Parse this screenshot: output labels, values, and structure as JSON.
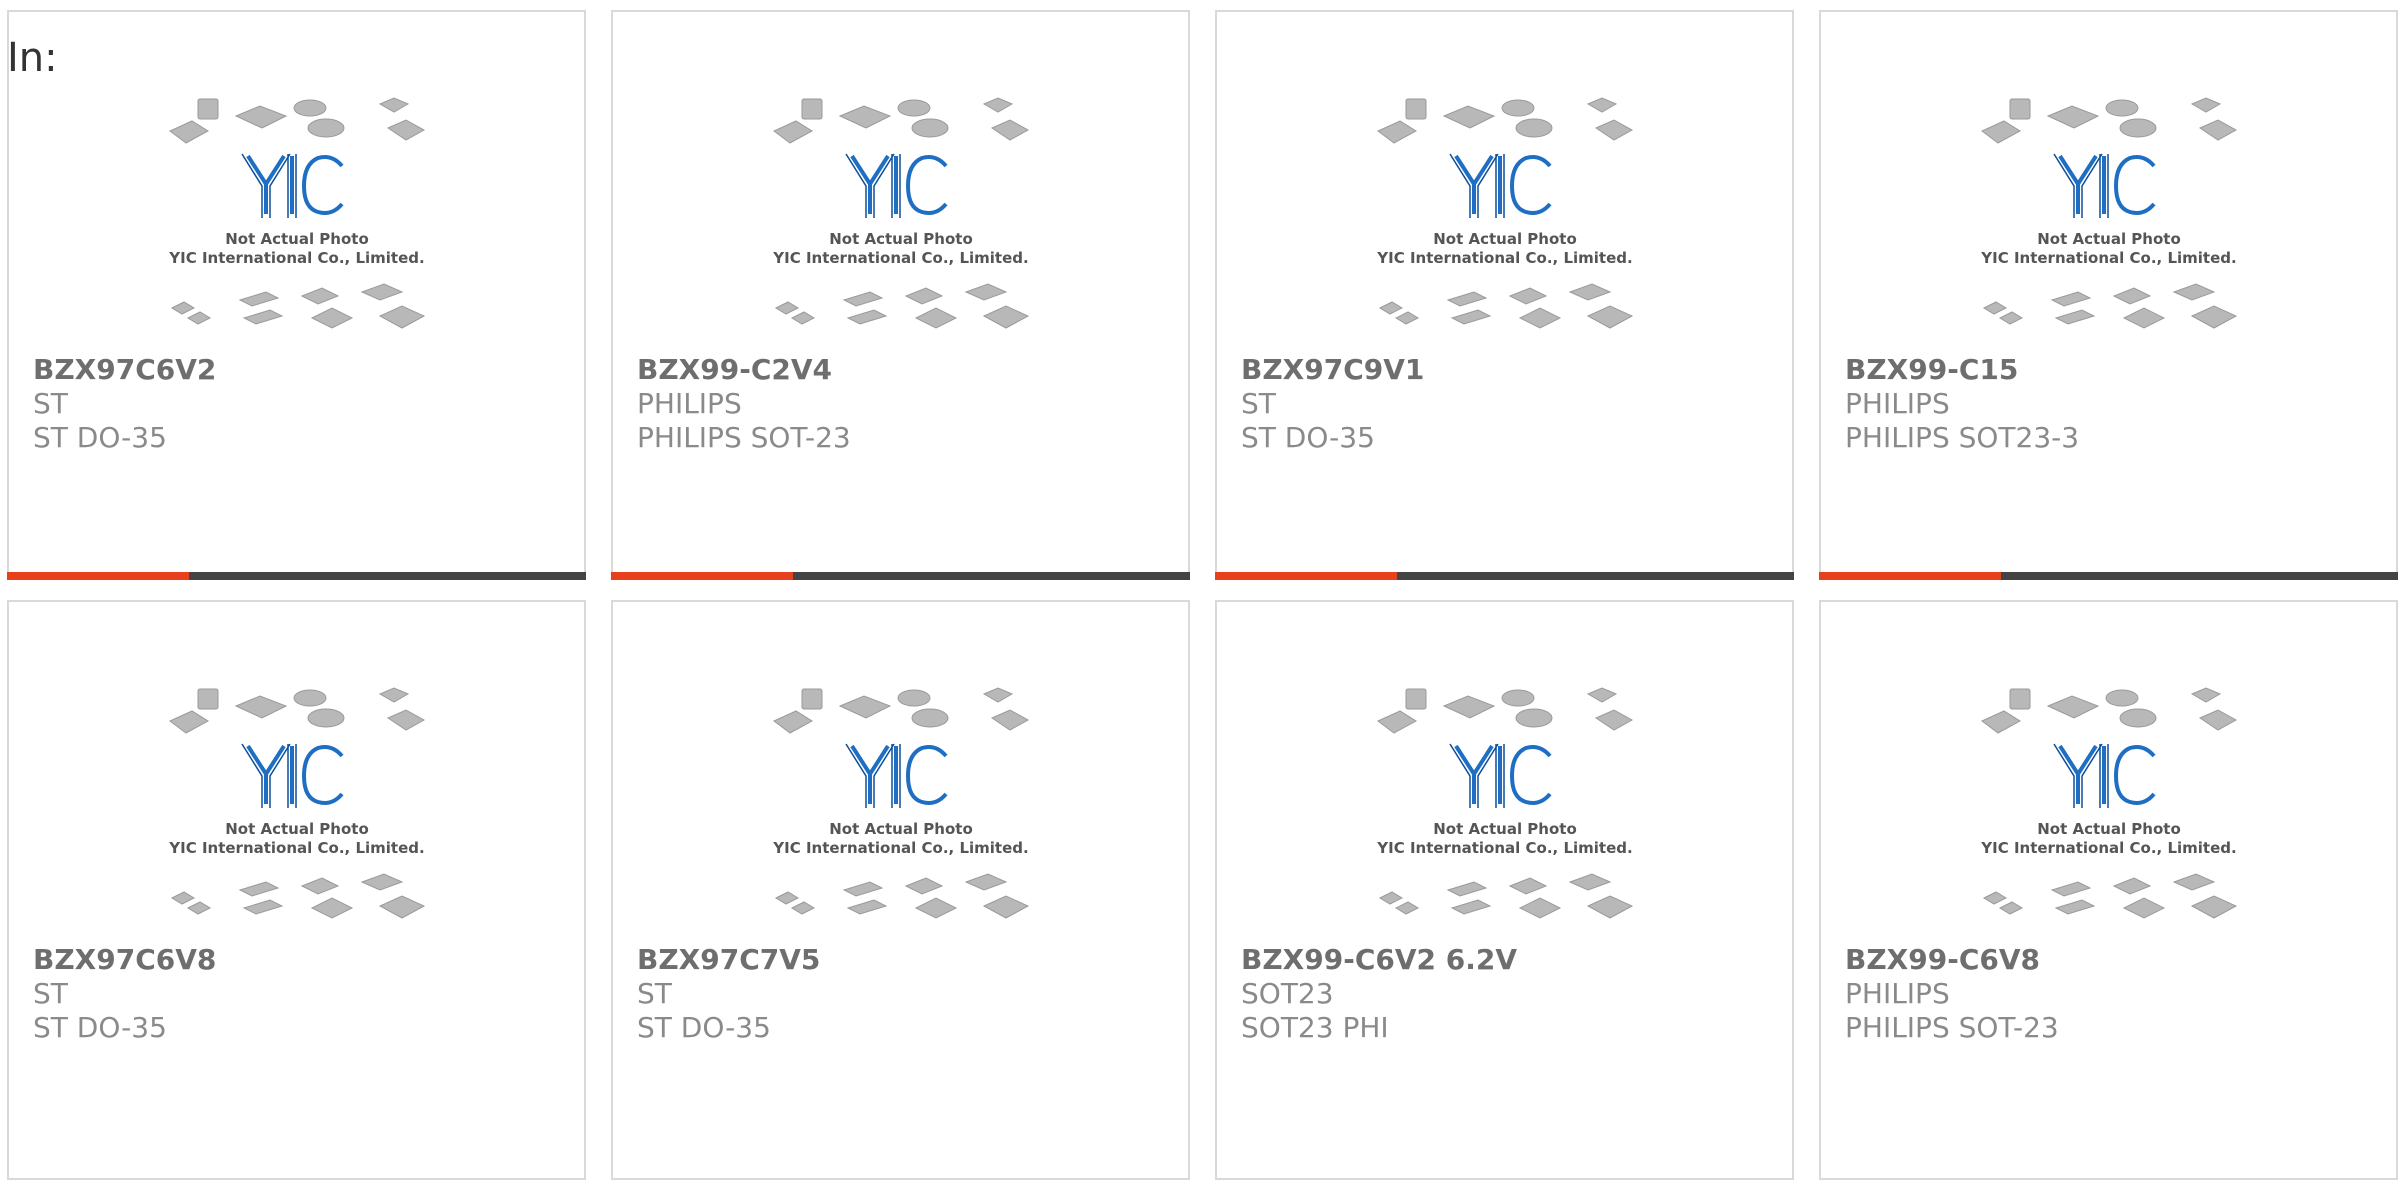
{
  "header": {
    "label": "In:"
  },
  "placeholder": {
    "line1": "Not Actual Photo",
    "line2": "YIC International Co., Limited.",
    "logo_text": "YIC"
  },
  "colors": {
    "accent": "#e8401c",
    "bar": "#444444",
    "logo": "#1e6fc4"
  },
  "products": [
    {
      "part": "BZX97C6V2",
      "brand": "ST",
      "package": "ST DO-35"
    },
    {
      "part": "BZX99-C2V4",
      "brand": "PHILIPS",
      "package": "PHILIPS SOT-23"
    },
    {
      "part": "BZX97C9V1",
      "brand": "ST",
      "package": "ST DO-35"
    },
    {
      "part": "BZX99-C15",
      "brand": "PHILIPS",
      "package": "PHILIPS SOT23-3"
    },
    {
      "part": "BZX97C6V8",
      "brand": "ST",
      "package": "ST DO-35"
    },
    {
      "part": "BZX97C7V5",
      "brand": "ST",
      "package": "ST DO-35"
    },
    {
      "part": "BZX99-C6V2 6.2V",
      "brand": "SOT23",
      "package": "SOT23 PHI"
    },
    {
      "part": "BZX99-C6V8",
      "brand": "PHILIPS",
      "package": "PHILIPS SOT-23"
    }
  ]
}
